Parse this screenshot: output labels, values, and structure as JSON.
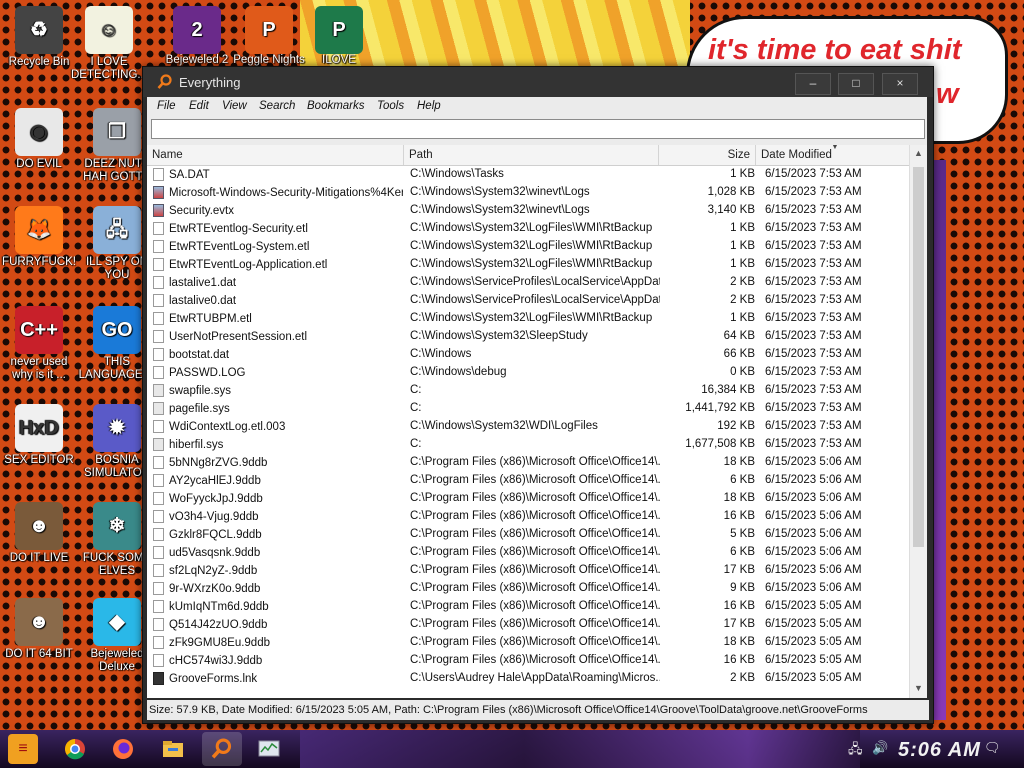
{
  "desktop": {
    "speech_line1": "it's time to eat shit",
    "speech_line2": "w",
    "icons": [
      {
        "label": "Recycle Bin",
        "icon": "recycle-bin-icon",
        "color": "#444444"
      },
      {
        "label": "I LOVE DETECTING...",
        "icon": "cartoon-icon",
        "color": "#f2f2e0"
      },
      {
        "label": "Bejeweled 2",
        "icon": "bejeweled-icon",
        "color": "#6a2a8a"
      },
      {
        "label": "Peggle Nights",
        "icon": "peggle-icon",
        "color": "#e05a1a"
      },
      {
        "label": "ILOVE",
        "icon": "publisher-icon",
        "color": "#1e7a4a"
      },
      {
        "label": "DO EVIL",
        "icon": "chrome-icon",
        "color": "#e8e8e8"
      },
      {
        "label": "DEEZ NUTS HAH GOTT...",
        "icon": "windows-icon",
        "color": "#9aa0a8"
      },
      {
        "label": "FURRYFUCK!",
        "icon": "firefox-icon",
        "color": "#ff7a1a"
      },
      {
        "label": "ILL SPY ON YOU",
        "icon": "network-icon",
        "color": "#8ab0d8"
      },
      {
        "label": "never used why is it ...",
        "icon": "devcpp-icon",
        "color": "#c8202a"
      },
      {
        "label": "THIS LANGUAGE ...",
        "icon": "goland-icon",
        "color": "#1a7ad8"
      },
      {
        "label": "SEX EDITOR",
        "icon": "hxd-icon",
        "color": "#f0f0f0"
      },
      {
        "label": "BOSNIA SIMULATOR",
        "icon": "mine-icon",
        "color": "#5a5ac8"
      },
      {
        "label": "DO IT LIVE",
        "icon": "portrait-icon",
        "color": "#7a5a3a"
      },
      {
        "label": "FUCK SOME ELVES",
        "icon": "elf-icon",
        "color": "#3a8a8a"
      },
      {
        "label": "DO IT 64 BIT",
        "icon": "portrait-64-icon",
        "color": "#8a6a4a"
      },
      {
        "label": "Bejeweled Deluxe",
        "icon": "gem-icon",
        "color": "#2ab8e8"
      }
    ]
  },
  "window": {
    "title": "Everything",
    "controls": {
      "minimize": "–",
      "maximize": "□",
      "close": "×"
    },
    "menu": [
      "File",
      "Edit",
      "View",
      "Search",
      "Bookmarks",
      "Tools",
      "Help"
    ],
    "search": {
      "value": "",
      "placeholder": ""
    },
    "columns": {
      "name": "Name",
      "path": "Path",
      "size": "Size",
      "date": "Date Modified"
    },
    "rows": [
      {
        "name": "SA.DAT",
        "path": "C:\\Windows\\Tasks",
        "size": "1 KB",
        "date": "6/15/2023 7:53 AM",
        "icon": "file"
      },
      {
        "name": "Microsoft-Windows-Security-Mitigations%4Kern...",
        "path": "C:\\Windows\\System32\\winevt\\Logs",
        "size": "1,028 KB",
        "date": "6/15/2023 7:53 AM",
        "icon": "evt"
      },
      {
        "name": "Security.evtx",
        "path": "C:\\Windows\\System32\\winevt\\Logs",
        "size": "3,140 KB",
        "date": "6/15/2023 7:53 AM",
        "icon": "evt"
      },
      {
        "name": "EtwRTEventlog-Security.etl",
        "path": "C:\\Windows\\System32\\LogFiles\\WMI\\RtBackup",
        "size": "1 KB",
        "date": "6/15/2023 7:53 AM",
        "icon": "file"
      },
      {
        "name": "EtwRTEventLog-System.etl",
        "path": "C:\\Windows\\System32\\LogFiles\\WMI\\RtBackup",
        "size": "1 KB",
        "date": "6/15/2023 7:53 AM",
        "icon": "file"
      },
      {
        "name": "EtwRTEventLog-Application.etl",
        "path": "C:\\Windows\\System32\\LogFiles\\WMI\\RtBackup",
        "size": "1 KB",
        "date": "6/15/2023 7:53 AM",
        "icon": "file"
      },
      {
        "name": "lastalive1.dat",
        "path": "C:\\Windows\\ServiceProfiles\\LocalService\\AppDat...",
        "size": "2 KB",
        "date": "6/15/2023 7:53 AM",
        "icon": "file"
      },
      {
        "name": "lastalive0.dat",
        "path": "C:\\Windows\\ServiceProfiles\\LocalService\\AppDat...",
        "size": "2 KB",
        "date": "6/15/2023 7:53 AM",
        "icon": "file"
      },
      {
        "name": "EtwRTUBPM.etl",
        "path": "C:\\Windows\\System32\\LogFiles\\WMI\\RtBackup",
        "size": "1 KB",
        "date": "6/15/2023 7:53 AM",
        "icon": "file"
      },
      {
        "name": "UserNotPresentSession.etl",
        "path": "C:\\Windows\\System32\\SleepStudy",
        "size": "64 KB",
        "date": "6/15/2023 7:53 AM",
        "icon": "file"
      },
      {
        "name": "bootstat.dat",
        "path": "C:\\Windows",
        "size": "66 KB",
        "date": "6/15/2023 7:53 AM",
        "icon": "file"
      },
      {
        "name": "PASSWD.LOG",
        "path": "C:\\Windows\\debug",
        "size": "0 KB",
        "date": "6/15/2023 7:53 AM",
        "icon": "file"
      },
      {
        "name": "swapfile.sys",
        "path": "C:",
        "size": "16,384 KB",
        "date": "6/15/2023 7:53 AM",
        "icon": "sys"
      },
      {
        "name": "pagefile.sys",
        "path": "C:",
        "size": "1,441,792 KB",
        "date": "6/15/2023 7:53 AM",
        "icon": "sys"
      },
      {
        "name": "WdiContextLog.etl.003",
        "path": "C:\\Windows\\System32\\WDI\\LogFiles",
        "size": "192 KB",
        "date": "6/15/2023 7:53 AM",
        "icon": "file"
      },
      {
        "name": "hiberfil.sys",
        "path": "C:",
        "size": "1,677,508 KB",
        "date": "6/15/2023 7:53 AM",
        "icon": "sys"
      },
      {
        "name": "5bNNg8rZVG.9ddb",
        "path": "C:\\Program Files (x86)\\Microsoft Office\\Office14\\...",
        "size": "18 KB",
        "date": "6/15/2023 5:06 AM",
        "icon": "file"
      },
      {
        "name": "AY2ycaHlEJ.9ddb",
        "path": "C:\\Program Files (x86)\\Microsoft Office\\Office14\\...",
        "size": "6 KB",
        "date": "6/15/2023 5:06 AM",
        "icon": "file"
      },
      {
        "name": "WoFyyckJpJ.9ddb",
        "path": "C:\\Program Files (x86)\\Microsoft Office\\Office14\\...",
        "size": "18 KB",
        "date": "6/15/2023 5:06 AM",
        "icon": "file"
      },
      {
        "name": "vO3h4-Vjug.9ddb",
        "path": "C:\\Program Files (x86)\\Microsoft Office\\Office14\\...",
        "size": "16 KB",
        "date": "6/15/2023 5:06 AM",
        "icon": "file"
      },
      {
        "name": "Gzklr8FQCL.9ddb",
        "path": "C:\\Program Files (x86)\\Microsoft Office\\Office14\\...",
        "size": "5 KB",
        "date": "6/15/2023 5:06 AM",
        "icon": "file"
      },
      {
        "name": "ud5Vasqsnk.9ddb",
        "path": "C:\\Program Files (x86)\\Microsoft Office\\Office14\\...",
        "size": "6 KB",
        "date": "6/15/2023 5:06 AM",
        "icon": "file"
      },
      {
        "name": "sf2LqN2yZ-.9ddb",
        "path": "C:\\Program Files (x86)\\Microsoft Office\\Office14\\...",
        "size": "17 KB",
        "date": "6/15/2023 5:06 AM",
        "icon": "file"
      },
      {
        "name": "9r-WXrzK0o.9ddb",
        "path": "C:\\Program Files (x86)\\Microsoft Office\\Office14\\...",
        "size": "9 KB",
        "date": "6/15/2023 5:06 AM",
        "icon": "file"
      },
      {
        "name": "kUmIqNTm6d.9ddb",
        "path": "C:\\Program Files (x86)\\Microsoft Office\\Office14\\...",
        "size": "16 KB",
        "date": "6/15/2023 5:05 AM",
        "icon": "file"
      },
      {
        "name": "Q514J42zUO.9ddb",
        "path": "C:\\Program Files (x86)\\Microsoft Office\\Office14\\...",
        "size": "17 KB",
        "date": "6/15/2023 5:05 AM",
        "icon": "file"
      },
      {
        "name": "zFk9GMU8Eu.9ddb",
        "path": "C:\\Program Files (x86)\\Microsoft Office\\Office14\\...",
        "size": "18 KB",
        "date": "6/15/2023 5:05 AM",
        "icon": "file"
      },
      {
        "name": "cHC574wi3J.9ddb",
        "path": "C:\\Program Files (x86)\\Microsoft Office\\Office14\\...",
        "size": "16 KB",
        "date": "6/15/2023 5:05 AM",
        "icon": "file"
      },
      {
        "name": "GrooveForms.lnk",
        "path": "C:\\Users\\Audrey Hale\\AppData\\Roaming\\Micros...",
        "size": "2 KB",
        "date": "6/15/2023 5:05 AM",
        "icon": "lnk"
      }
    ],
    "status": "Size: 57.9 KB, Date Modified: 6/15/2023 5:05 AM, Path: C:\\Program Files (x86)\\Microsoft Office\\Office14\\Groove\\ToolData\\groove.net\\GrooveForms"
  },
  "taskbar": {
    "clock": "5:06 AM",
    "items": [
      "start-icon",
      "chrome-icon",
      "firefox-icon",
      "file-explorer-icon",
      "everything-icon",
      "task-manager-icon"
    ]
  }
}
